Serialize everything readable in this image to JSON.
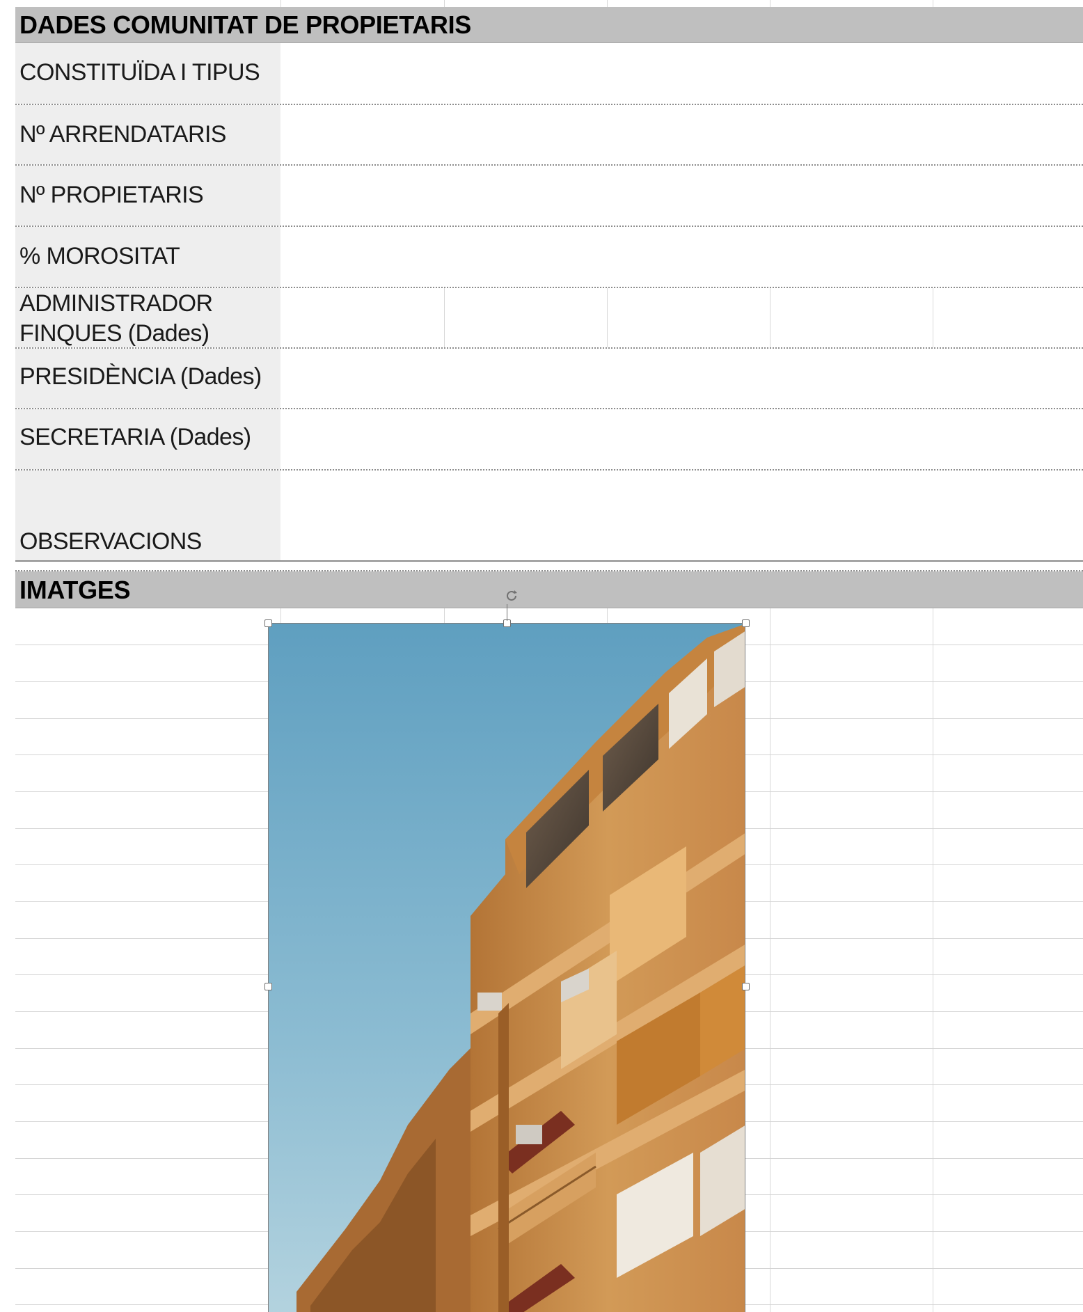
{
  "sheet": {
    "section_header": "DADES COMUNITAT DE PROPIETARIS",
    "rows": [
      {
        "label": "CONSTITUÏDA I TIPUS",
        "value": ""
      },
      {
        "label": "Nº ARRENDATARIS",
        "value": ""
      },
      {
        "label": "Nº PROPIETARIS",
        "value": ""
      },
      {
        "label": "% MOROSITAT",
        "value": ""
      },
      {
        "label_line1": "ADMINISTRADOR",
        "label_line2": "FINQUES (Dades)",
        "value": ""
      },
      {
        "label": "PRESIDÈNCIA (Dades)",
        "value": ""
      },
      {
        "label": "SECRETARIA (Dades)",
        "value": ""
      },
      {
        "label": "OBSERVACIONS",
        "value": ""
      }
    ],
    "images_header": "IMATGES"
  },
  "picture": {
    "icon": "building-photo-icon",
    "sky_color": "#6aa6c4",
    "facade_color": "#c98a4a"
  },
  "colors": {
    "header_bg": "#bfbfbf",
    "label_bg": "#eeeeee",
    "grid": "#d8d8d8"
  }
}
